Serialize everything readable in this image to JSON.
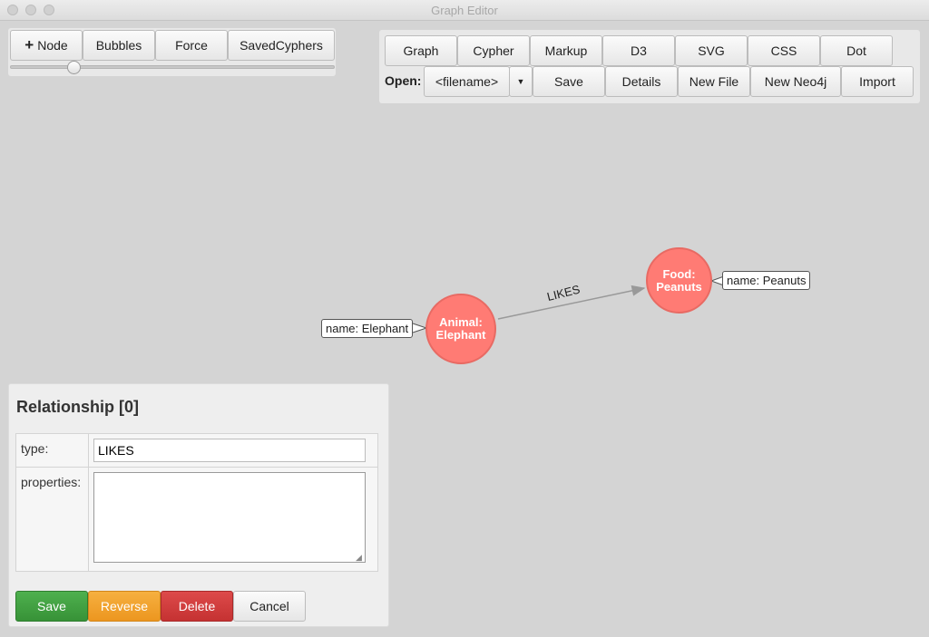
{
  "window": {
    "title": "Graph Editor"
  },
  "toolbar_left": {
    "add_node_icon": "plus-icon",
    "node_label": "Node",
    "bubbles_label": "Bubbles",
    "force_label": "Force",
    "saved_cyphers_label": "SavedCyphers",
    "zoom_slider_value": 0.2
  },
  "toolbar_right": {
    "views": [
      "Graph",
      "Cypher",
      "Markup",
      "D3",
      "SVG",
      "CSS",
      "Dot"
    ],
    "open_label": "Open:",
    "filename_value": "<filename>",
    "dropdown_icon": "caret-down-icon",
    "save_label": "Save",
    "details_label": "Details",
    "new_file_label": "New File",
    "new_neo4j_label": "New Neo4j",
    "import_label": "Import"
  },
  "graph": {
    "nodes": [
      {
        "label_line1": "Animal:",
        "label_line2": "Elephant",
        "property": "name: Elephant"
      },
      {
        "label_line1": "Food:",
        "label_line2": "Peanuts",
        "property": "name: Peanuts"
      }
    ],
    "edge": {
      "label": "LIKES"
    },
    "colors": {
      "node_fill": "#ff7b74",
      "edge": "#999999"
    }
  },
  "relationship_panel": {
    "title": "Relationship [0]",
    "type_label": "type:",
    "type_value": "LIKES",
    "properties_label": "properties:",
    "properties_value": "",
    "save_label": "Save",
    "reverse_label": "Reverse",
    "delete_label": "Delete",
    "cancel_label": "Cancel",
    "colors": {
      "save": "#3e9a3e",
      "reverse": "#f0a030",
      "delete": "#d03838"
    }
  }
}
